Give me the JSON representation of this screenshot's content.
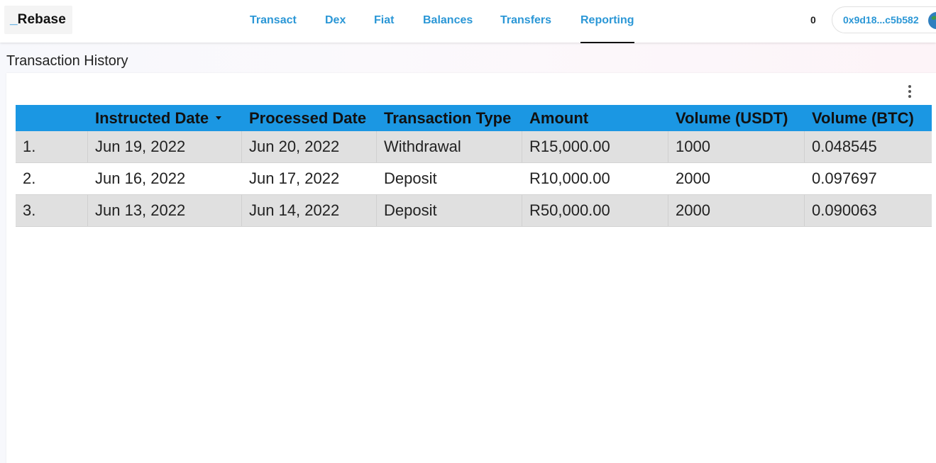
{
  "header": {
    "logo_prefix": "_",
    "logo_name": "Rebase",
    "nav": [
      {
        "label": "Transact",
        "active": false
      },
      {
        "label": "Dex",
        "active": false
      },
      {
        "label": "Fiat",
        "active": false
      },
      {
        "label": "Balances",
        "active": false
      },
      {
        "label": "Transfers",
        "active": false
      },
      {
        "label": "Reporting",
        "active": true
      }
    ],
    "counter": "0",
    "wallet_address": "0x9d18...c5b582"
  },
  "page": {
    "title": "Transaction History"
  },
  "table": {
    "columns": [
      "",
      "Instructed Date",
      "Processed Date",
      "Transaction Type",
      "Amount",
      "Volume (USDT)",
      "Volume (BTC)"
    ],
    "sorted_column": "Instructed Date",
    "rows": [
      [
        "1.",
        "Jun 19, 2022",
        "Jun 20, 2022",
        "Withdrawal",
        "R15,000.00",
        "1000",
        "0.048545"
      ],
      [
        "2.",
        "Jun 16, 2022",
        "Jun 17, 2022",
        "Deposit",
        "R10,000.00",
        "2000",
        "0.097697"
      ],
      [
        "3.",
        "Jun 13, 2022",
        "Jun 14, 2022",
        "Deposit",
        "R50,000.00",
        "2000",
        "0.090063"
      ]
    ]
  },
  "colors": {
    "accent": "#2b97d6",
    "table_header": "#1b97e3",
    "stripe": "#e0e0e0"
  },
  "icons": {
    "sort": "caret-down-icon",
    "menu": "more-vert-icon",
    "avatar": "globe-avatar-icon"
  }
}
